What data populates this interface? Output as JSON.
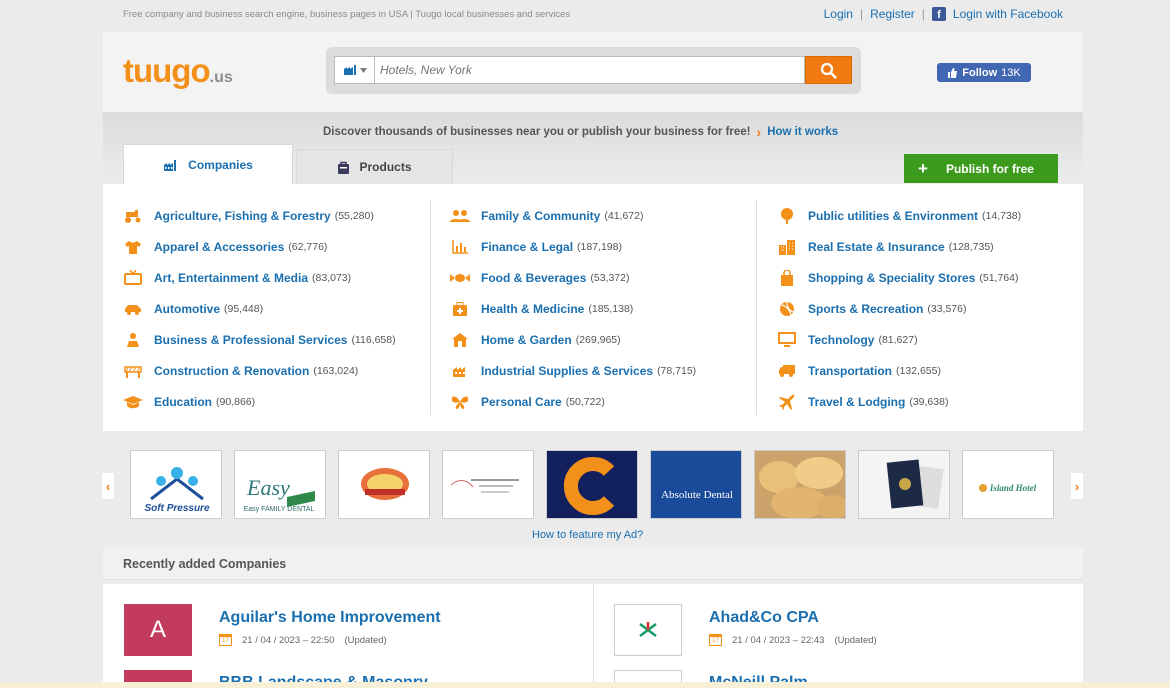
{
  "topbar": {
    "tagline": "Free company and business search engine, business pages in USA | Tuugo local businesses and services",
    "login": "Login",
    "register": "Register",
    "login_facebook": "Login with Facebook",
    "separator": "|"
  },
  "header": {
    "logo_main": "tuugo",
    "logo_tld": ".us",
    "search_placeholder": "Hotels, New York",
    "fb_follow": "Follow",
    "fb_count": "13K"
  },
  "banner": {
    "discover": "Discover thousands of businesses near you or publish your business for free!",
    "arrow": "›",
    "how_it_works": "How it works",
    "tab_companies": "Companies",
    "tab_products": "Products",
    "publish": "Publish for free",
    "publish_plus": "+"
  },
  "categories": {
    "col1": [
      {
        "name": "Agriculture, Fishing & Forestry",
        "count": "(55,280)",
        "icon": "tractor-icon"
      },
      {
        "name": "Apparel & Accessories",
        "count": "(62,776)",
        "icon": "shirt-icon"
      },
      {
        "name": "Art, Entertainment & Media",
        "count": "(83,073)",
        "icon": "tv-icon"
      },
      {
        "name": "Automotive",
        "count": "(95,448)",
        "icon": "car-icon"
      },
      {
        "name": "Business & Professional Services",
        "count": "(116,658)",
        "icon": "person-icon"
      },
      {
        "name": "Construction & Renovation",
        "count": "(163,024)",
        "icon": "barrier-icon"
      },
      {
        "name": "Education",
        "count": "(90,866)",
        "icon": "graduation-cap-icon"
      }
    ],
    "col2": [
      {
        "name": "Family & Community",
        "count": "(41,672)",
        "icon": "people-icon"
      },
      {
        "name": "Finance & Legal",
        "count": "(187,198)",
        "icon": "bar-chart-icon"
      },
      {
        "name": "Food & Beverages",
        "count": "(53,372)",
        "icon": "candy-icon"
      },
      {
        "name": "Health & Medicine",
        "count": "(185,138)",
        "icon": "medkit-icon"
      },
      {
        "name": "Home & Garden",
        "count": "(269,965)",
        "icon": "house-icon"
      },
      {
        "name": "Industrial Supplies & Services",
        "count": "(78,715)",
        "icon": "factory-icon"
      },
      {
        "name": "Personal Care",
        "count": "(50,722)",
        "icon": "butterfly-icon"
      }
    ],
    "col3": [
      {
        "name": "Public utilities & Environment",
        "count": "(14,738)",
        "icon": "tree-icon"
      },
      {
        "name": "Real Estate & Insurance",
        "count": "(128,735)",
        "icon": "building-icon"
      },
      {
        "name": "Shopping & Speciality Stores",
        "count": "(51,764)",
        "icon": "shopping-bag-icon"
      },
      {
        "name": "Sports & Recreation",
        "count": "(33,576)",
        "icon": "ball-icon"
      },
      {
        "name": "Technology",
        "count": "(81,627)",
        "icon": "monitor-icon"
      },
      {
        "name": "Transportation",
        "count": "(132,655)",
        "icon": "truck-icon"
      },
      {
        "name": "Travel & Lodging",
        "count": "(39,638)",
        "icon": "plane-icon"
      }
    ]
  },
  "ads": {
    "prev": "‹",
    "next": "›",
    "how_to_feature": "How to feature my Ad?",
    "items": [
      {
        "text": "Soft Pressure"
      },
      {
        "text": "Easy FAMILY DENTAL"
      },
      {
        "text": ""
      },
      {
        "text": ""
      },
      {
        "text": "C"
      },
      {
        "text": "Absolute Dental"
      },
      {
        "text": ""
      },
      {
        "text": ""
      },
      {
        "text": "Island Hotel"
      }
    ]
  },
  "recent": {
    "heading": "Recently added Companies",
    "items": [
      {
        "letter": "A",
        "title": "Aguilar's Home Improvement",
        "date": "21 / 04 / 2023 – 22:50",
        "status": "(Updated)"
      },
      {
        "letter": "",
        "title": "Ahad&Co CPA",
        "date": "21 / 04 / 2023 – 22:43",
        "status": "(Updated)"
      },
      {
        "letter": "",
        "title": "BBB Landscape & Masonry",
        "date": "",
        "status": ""
      },
      {
        "letter": "",
        "title": "McNeill Palm",
        "date": "",
        "status": ""
      }
    ]
  },
  "colors": {
    "accent": "#f07a10",
    "link": "#1a6fb0",
    "publish": "#3c9b1d",
    "avatar": "#c23a5c"
  }
}
